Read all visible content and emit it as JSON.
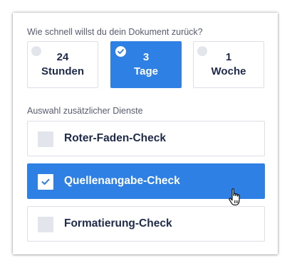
{
  "speed": {
    "question": "Wie schnell willst du dein Dokument zurück?",
    "options": [
      {
        "line1": "24",
        "line2": "Stunden",
        "selected": false
      },
      {
        "line1": "3",
        "line2": "Tage",
        "selected": true
      },
      {
        "line1": "1",
        "line2": "Woche",
        "selected": false
      }
    ]
  },
  "services": {
    "heading": "Auswahl zusätzlicher Dienste",
    "items": [
      {
        "label": "Roter-Faden-Check",
        "checked": false
      },
      {
        "label": "Quellenangabe-Check",
        "checked": true
      },
      {
        "label": "Formatierung-Check",
        "checked": false
      }
    ]
  },
  "colors": {
    "accent": "#2f80e4",
    "text_dark": "#1e2a4a",
    "text_muted": "#565c6e",
    "border": "#dcdfe6",
    "unchecked_fill": "#e3e5ec"
  },
  "icons": {
    "selected_radio": "check-circle-icon",
    "checked_box": "check-icon",
    "cursor": "hand-pointer-cursor-icon"
  }
}
